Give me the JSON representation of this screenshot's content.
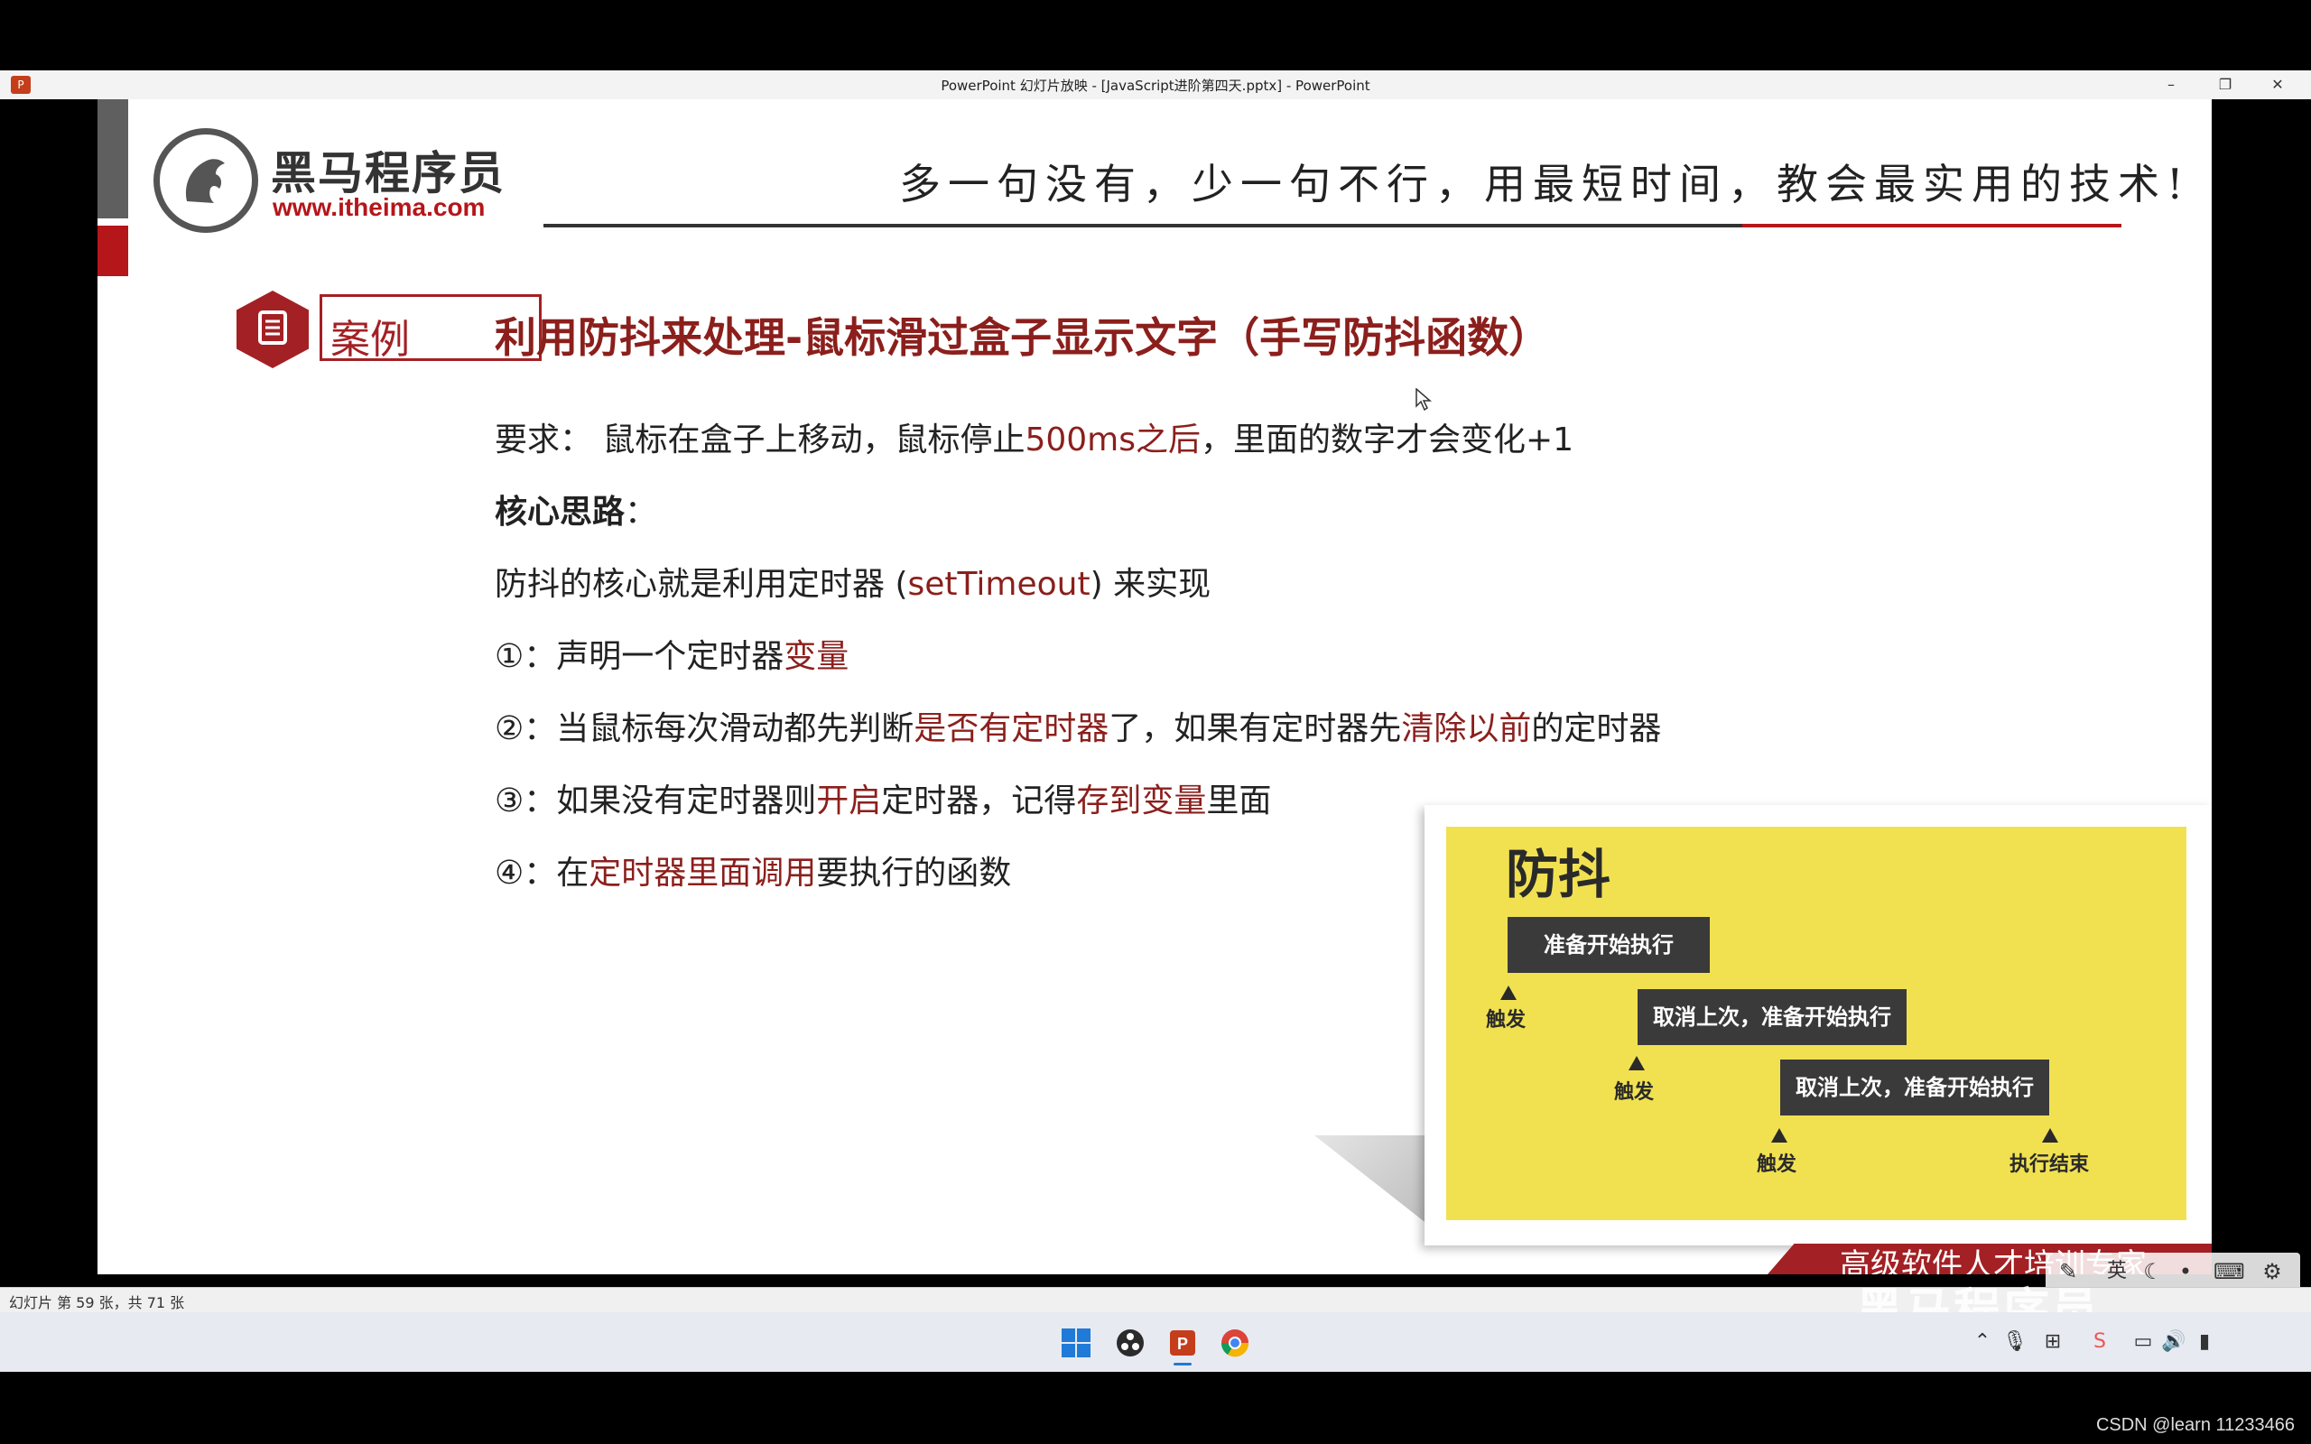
{
  "window": {
    "title": "PowerPoint 幻灯片放映 - [JavaScript进阶第四天.pptx] - PowerPoint",
    "app_icon": "powerpoint-icon",
    "controls": {
      "minimize": "–",
      "restore": "❐",
      "close": "✕"
    }
  },
  "slide": {
    "logo_cn": "黑马程序员",
    "logo_url": "www.itheima.com",
    "slogan": "多一句没有，少一句不行，用最短时间，教会最实用的技术!",
    "case_label": "案例",
    "title": "利用防抖来处理-鼠标滑过盒子显示文字（手写防抖函数）",
    "requirement": {
      "a": "要求： 鼠标在盒子上移动，鼠标停止",
      "b": "500ms之后",
      "c": "，里面的数字才会变化+1"
    },
    "core_heading": "核心思路",
    "core_colon": "：",
    "principle": {
      "a": "防抖的核心就是利用定时器 (",
      "b": "setTimeout",
      "c": ") 来实现"
    },
    "step1": {
      "a": "①：声明一个定时器",
      "b": "变量"
    },
    "step2": {
      "a": "②：当鼠标每次滑动都先判断",
      "b": "是否有定时器",
      "c": "了，如果有定时器先",
      "d": "清除以前",
      "e": "的定时器"
    },
    "step3": {
      "a": "③：如果没有定时器则",
      "b": "开启",
      "c": "定时器，记得",
      "d": "存到变量",
      "e": "里面"
    },
    "step4": {
      "a": "④：在",
      "b": "定时器里面调用",
      "c": "要执行的函数"
    },
    "diagram": {
      "title": "防抖",
      "box1": "准备开始执行",
      "box2": "取消上次，准备开始执行",
      "box3": "取消上次，准备开始执行",
      "trigger": "触发",
      "end": "执行结束",
      "bg_color": "#f1e151"
    },
    "footer": "高级软件人才培训专家",
    "accent_color": "#a32024"
  },
  "slideshow_toolbar": {
    "icons": [
      "pen-icon",
      "ime-icon",
      "moon-icon",
      "dot-icon",
      "keyboard-icon",
      "gear-icon"
    ],
    "ime_label": "英"
  },
  "status": {
    "slide_info": "幻灯片 第 59 张，共 71 张"
  },
  "watermark": "黑马程序员",
  "taskbar": {
    "apps": [
      "windows-start-icon",
      "obs-icon",
      "powerpoint-icon",
      "chrome-icon"
    ],
    "tray": [
      "chevron-up-icon",
      "mic-icon",
      "network-icon",
      "app-tray-icon",
      "display-icon",
      "volume-icon",
      "battery-icon"
    ]
  },
  "csdn_credit": "CSDN @learn 11233466"
}
